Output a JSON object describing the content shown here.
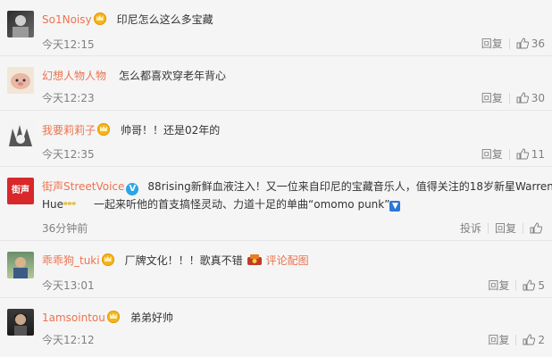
{
  "comments": [
    {
      "user": "So1Noisy",
      "text": "印尼怎么这么多宝藏",
      "time": "今天12:15",
      "reply": "回复",
      "likes": "36"
    },
    {
      "user": "幻想人物人物",
      "text": "怎么都喜欢穿老年背心",
      "time": "今天12:23",
      "reply": "回复",
      "likes": "30"
    },
    {
      "user": "我要莉莉子",
      "text": "帅哥！！还是02年的",
      "time": "今天12:35",
      "reply": "回复",
      "likes": "11"
    },
    {
      "user": "街声StreetVoice",
      "text": "88rising新鲜血液注入！又一位来自印尼的宝藏音乐人，值得关注的18岁新星Warren",
      "text2a": "Hue",
      "text2b": "一起来听他的首支搞怪灵动、力道十足的单曲“omomo punk”",
      "time": "36分钟前",
      "report": "投诉",
      "reply": "回复",
      "likes": ""
    },
    {
      "user": "乖乖狗_tuki",
      "text": "厂牌文化！！！歌真不错",
      "piclabel": "评论配图",
      "time": "今天13:01",
      "reply": "回复",
      "likes": "5"
    },
    {
      "user": "1amsointou",
      "text": "弟弟好帅",
      "time": "今天12:12",
      "reply": "回复",
      "likes": "2"
    }
  ],
  "avatars": {
    "a4": "街声"
  },
  "colors": {
    "username": "#eb7350",
    "time": "#808080",
    "text": "#333333"
  }
}
